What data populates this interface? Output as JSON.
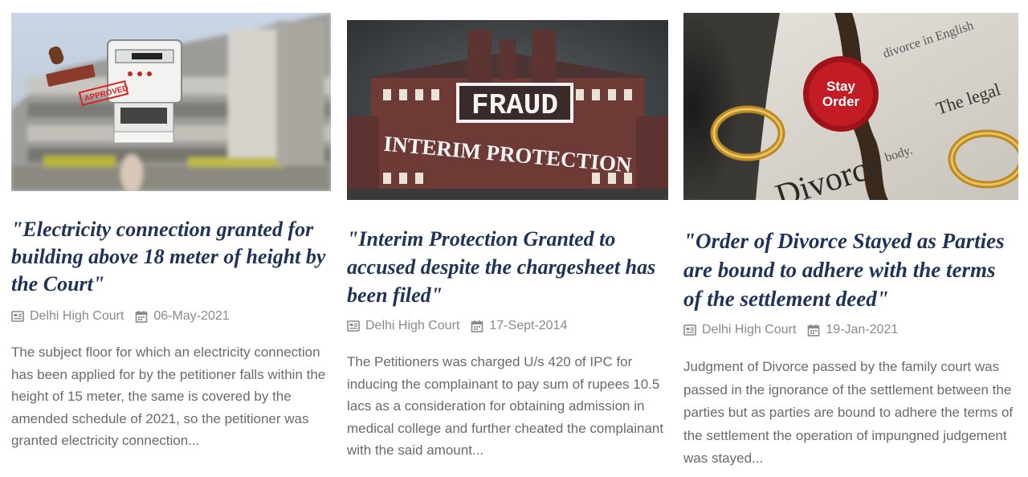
{
  "articles": [
    {
      "image_alt": "Electricity meter with approved stamp over blurred building",
      "title": "\"Electricity connection granted for building above 18 meter of height by the Court\"",
      "court": "Delhi High Court",
      "date": "06-May-2021",
      "excerpt": "The subject floor for which an electricity connection has been applied for by the petitioner falls within the height of 15 meter, the same is covered by the amended schedule of 2021, so the petitioner was granted electricity connection...",
      "stamp_text": "APPROVED"
    },
    {
      "image_alt": "Illustrated courthouse with stamped words",
      "image_text_1": "FRAUD",
      "image_text_2": "INTERIM PROTECTION",
      "title": "\"Interim Protection Granted to accused despite the chargesheet has been filed\"",
      "court": "Delhi High Court",
      "date": "17-Sept-2014",
      "excerpt": "The Petitioners was charged U/s 420 of IPC for inducing the complainant to pay sum of rupees 10.5 lacs as a consideration for obtaining admission in medical college and further cheated the complainant with the said amount..."
    },
    {
      "image_alt": "Torn divorce paper with wedding rings and wax seal",
      "seal_line_1": "Stay",
      "seal_line_2": "Order",
      "paper_text_main": "Divorce",
      "paper_text_1": "divorce in English",
      "paper_text_2": "The legal",
      "paper_text_3": "body.",
      "title": "\"Order of Divorce Stayed as Parties are bound to adhere with the terms of the settlement deed\"",
      "court": "Delhi High Court",
      "date": "19-Jan-2021",
      "excerpt": "Judgment of Divorce passed by the family court was passed in the ignorance of the settlement between the parties but as parties are bound to adhere the terms of the settlement the operation of impungned judgement was stayed..."
    }
  ],
  "colors": {
    "title": "#1f3258",
    "meta": "#8a8a8a",
    "excerpt": "#6a6a6a",
    "seal": "#b3121b"
  },
  "icons": {
    "court": "newspaper-icon",
    "date": "calendar-icon"
  }
}
